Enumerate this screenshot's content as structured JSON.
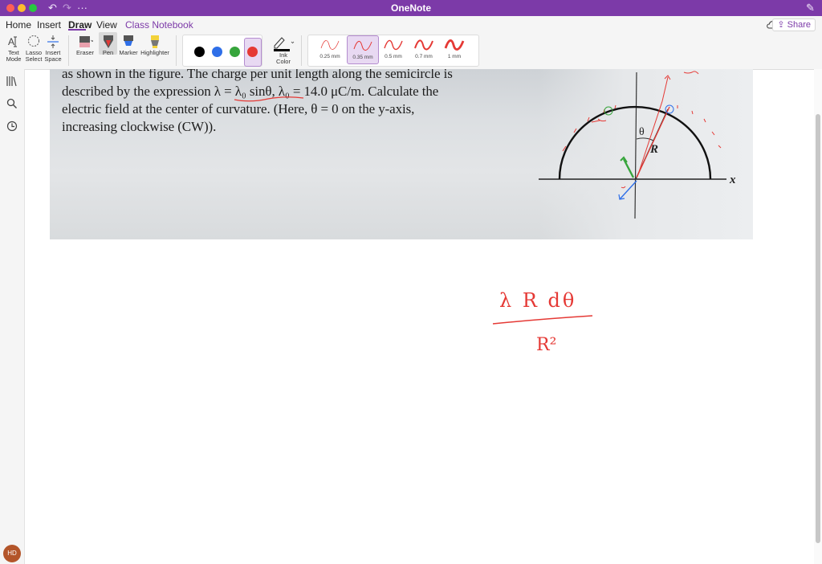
{
  "window": {
    "title": "OneNote"
  },
  "menu": {
    "tabs": [
      "Home",
      "Insert",
      "Draw",
      "View",
      "Class Notebook"
    ],
    "active_tab": "Draw",
    "share_label": "Share"
  },
  "ribbon": {
    "tools": [
      {
        "label1": "Text",
        "label2": "Mode"
      },
      {
        "label1": "Lasso",
        "label2": "Select"
      },
      {
        "label1": "Insert",
        "label2": "Space"
      },
      {
        "label1": "Eraser",
        "label2": ""
      },
      {
        "label1": "Pen",
        "label2": ""
      },
      {
        "label1": "Marker",
        "label2": ""
      },
      {
        "label1": "Highlighter",
        "label2": ""
      }
    ],
    "pen_colors": [
      "#000000",
      "#2f6fe8",
      "#37a53c",
      "#e53935"
    ],
    "selected_pen_color": "#e53935",
    "ink_color_label1": "Ink",
    "ink_color_label2": "Color",
    "thicknesses": [
      "0.25 mm",
      "0.35 mm",
      "0.5 mm",
      "0.7 mm",
      "1 mm"
    ],
    "selected_thickness": "0.35 mm"
  },
  "sidebar": {
    "avatar_initials": "HD"
  },
  "problem": {
    "lines": [
      "as shown in the figure. The charge per unit length along the semicircle is",
      "described by the expression λ = λ₀ sinθ, λ₀ = 14.0 μC/m. Calculate the",
      "electric field at the center of curvature. (Here, θ = 0 on the y-axis,",
      "increasing clockwise (CW))."
    ],
    "figure_labels": {
      "theta": "θ",
      "radius": "R",
      "x_axis": "x"
    }
  },
  "handwriting": {
    "numerator": "λ R dθ",
    "denominator": "R²"
  }
}
